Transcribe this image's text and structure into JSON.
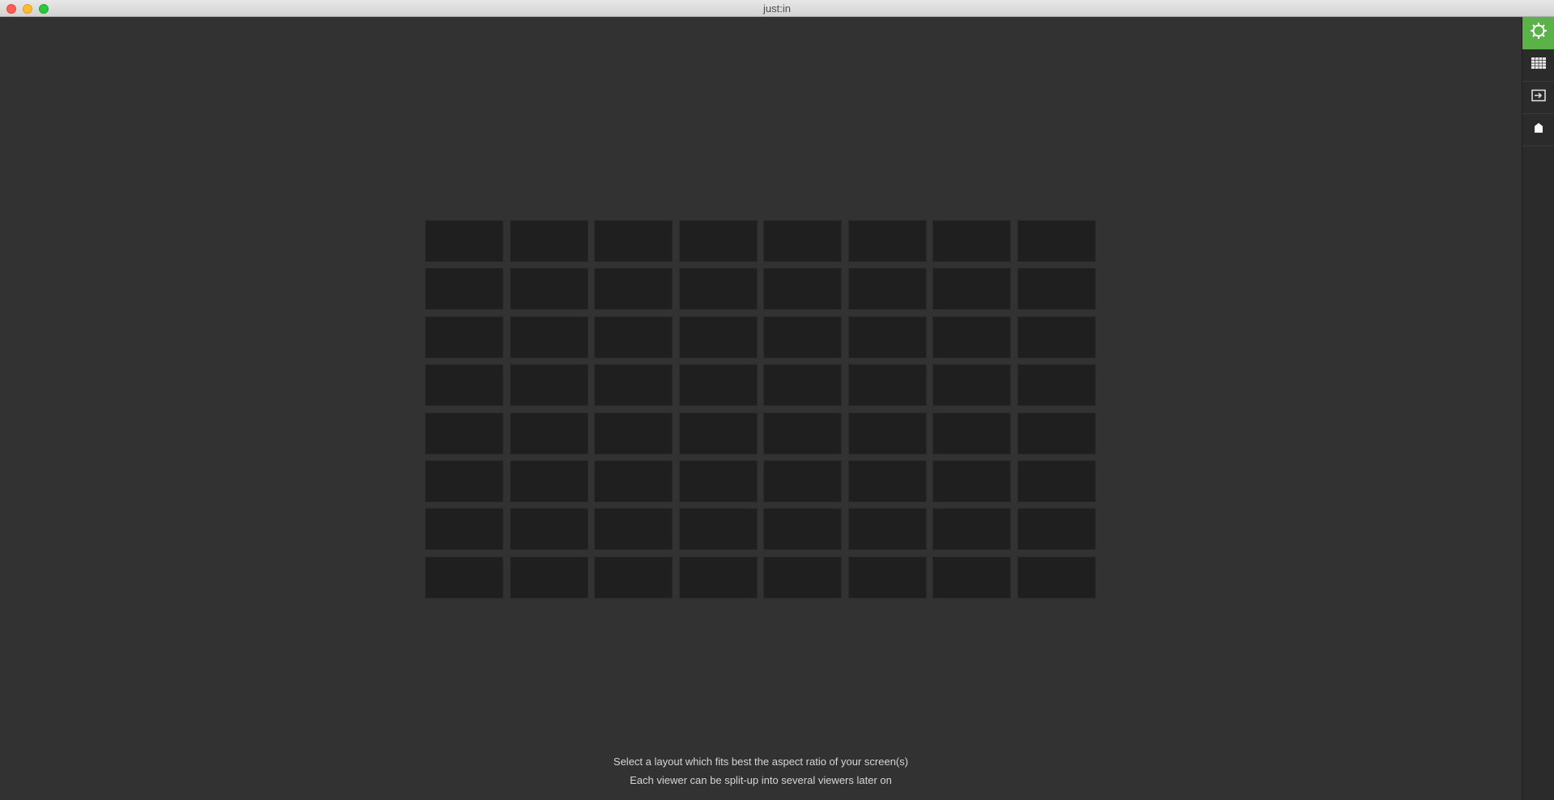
{
  "window": {
    "title": "just:in"
  },
  "layout_picker": {
    "rows": 8,
    "columns": 8
  },
  "hints": {
    "line1": "Select a layout which fits best the aspect ratio of your screen(s)",
    "line2": "Each viewer can be split-up into several viewers later on"
  },
  "sidebar": {
    "items": [
      {
        "icon": "gear-icon",
        "active": true
      },
      {
        "icon": "grid-icon",
        "active": false
      },
      {
        "icon": "input-icon",
        "active": false
      },
      {
        "icon": "tag-icon",
        "active": false
      }
    ]
  },
  "colors": {
    "accent": "#5bb248",
    "background": "#323232",
    "cell": "#1f1f1f"
  }
}
